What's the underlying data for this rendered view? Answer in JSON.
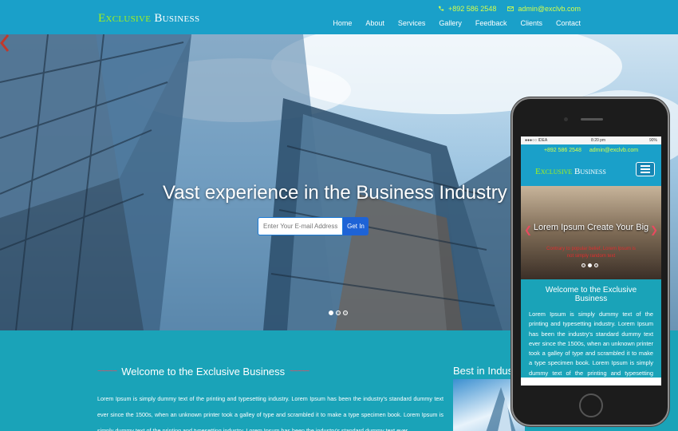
{
  "brand": {
    "word1": "Exclusive",
    "word2": "Business"
  },
  "contact": {
    "phone": "+892 586 2548",
    "email": "admin@exclvb.com"
  },
  "nav": [
    "Home",
    "About",
    "Services",
    "Gallery",
    "Feedback",
    "Clients",
    "Contact"
  ],
  "hero": {
    "title": "Vast experience in the Business Industry",
    "email_placeholder": "Enter Your E-mail Address",
    "button_label": "Get In"
  },
  "welcome": {
    "title": "Welcome to the Exclusive Business",
    "wave": "~~~~~",
    "body": "Lorem Ipsum is simply dummy text of the printing and typesetting industry. Lorem Ipsum has been the industry's standard dummy text ever since the 1500s, when an unknown printer took a galley of type and scrambled it to make a type specimen book. Lorem Ipsum is simply dummy text of the printing and typesetting industry. Lorem Ipsum has been the industry's standard dummy text ever"
  },
  "best": {
    "title": "Best in Indus"
  },
  "mobile": {
    "status_left": "●●●○○ IDEA",
    "status_time": "8:20 pm",
    "status_right": "90%",
    "slide_title": "Lorem Ipsum Create Your Big",
    "slide_sub": "Contrary to popular belief, Lorem Ipsum is not simply random text",
    "welcome_title": "Welcome to the Exclusive Business",
    "welcome_body": "Lorem Ipsum is simply dummy text of the printing and typesetting industry. Lorem Ipsum has been the industry's standard dummy text ever since the 1500s, when an unknown printer took a galley of type and scrambled it to make a type specimen book. Lorem Ipsum is simply dummy text of the printing and typesetting industry. Lorem"
  },
  "colors": {
    "header": "#1aa0c9",
    "section": "#1aa3b8",
    "accent_green": "#a6f21a",
    "button_blue": "#1e63d6",
    "wave_red": "#e84a5f"
  }
}
